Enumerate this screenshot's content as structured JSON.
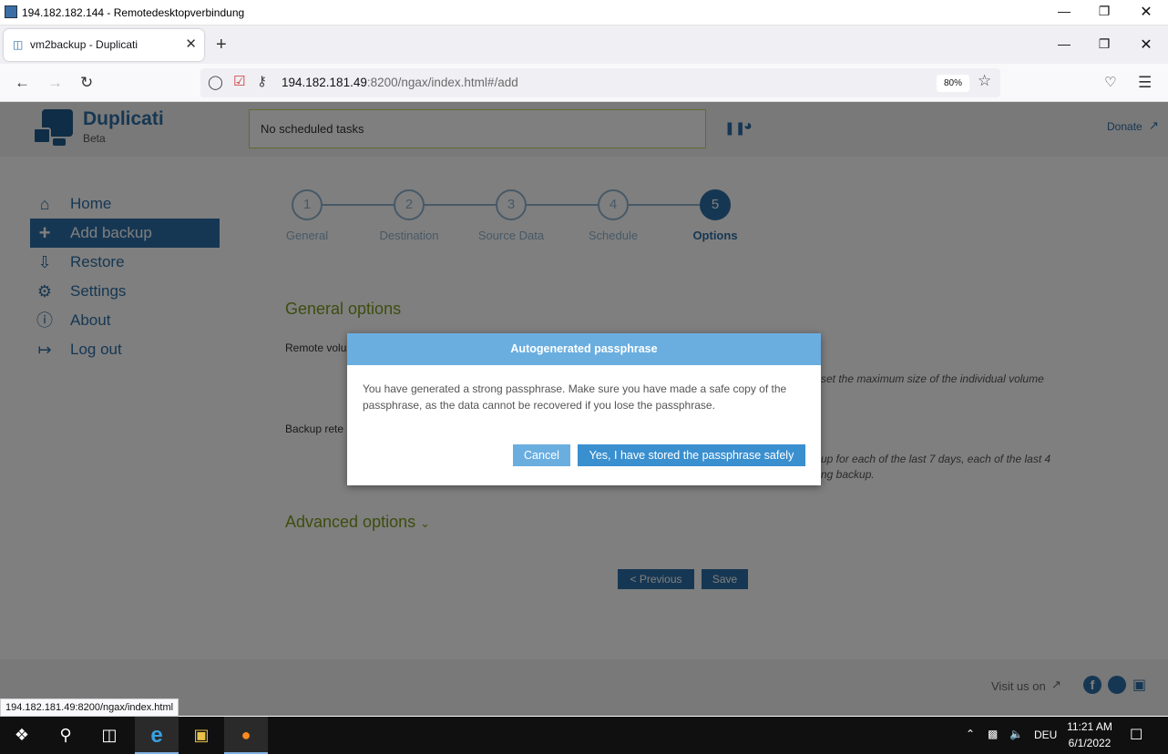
{
  "rdp": {
    "title": "194.182.182.144 - Remotedesktopverbindung"
  },
  "browser": {
    "tab_title": "vm2backup - Duplicati",
    "url_host": "194.182.181.49",
    "url_rest": ":8200/ngax/index.html#/add",
    "zoom": "80%",
    "status_url": "194.182.181.49:8200/ngax/index.html"
  },
  "app": {
    "brand": "Duplicati",
    "beta": "Beta",
    "status": "No scheduled tasks",
    "donate": "Donate",
    "sidebar": [
      {
        "label": "Home",
        "icon": "home-icon"
      },
      {
        "label": "Add backup",
        "icon": "plus-icon"
      },
      {
        "label": "Restore",
        "icon": "restore-icon"
      },
      {
        "label": "Settings",
        "icon": "gear-icon"
      },
      {
        "label": "About",
        "icon": "info-icon"
      },
      {
        "label": "Log out",
        "icon": "logout-icon"
      }
    ],
    "steps": [
      {
        "num": "1",
        "label": "General"
      },
      {
        "num": "2",
        "label": "Destination"
      },
      {
        "num": "3",
        "label": "Source Data"
      },
      {
        "num": "4",
        "label": "Schedule"
      },
      {
        "num": "5",
        "label": "Options"
      }
    ],
    "general_options": "General options",
    "remote_vol": "Remote volu",
    "remote_vol_desc": "set the maximum size of the individual volume",
    "backup_ret": "Backup rete",
    "backup_ret_desc1": "up for each of the last 7 days, each of the last 4",
    "backup_ret_desc2": "ng backup.",
    "advanced": "Advanced options",
    "previous": "< Previous",
    "save": "Save",
    "visit": "Visit us on"
  },
  "modal": {
    "title": "Autogenerated passphrase",
    "body": "You have generated a strong passphrase. Make sure you have made a safe copy of the passphrase, as the data cannot be recovered if you lose the passphrase.",
    "cancel": "Cancel",
    "confirm": "Yes, I have stored the passphrase safely"
  },
  "taskbar": {
    "lang": "DEU",
    "time": "11:21 AM",
    "date": "6/1/2022"
  }
}
